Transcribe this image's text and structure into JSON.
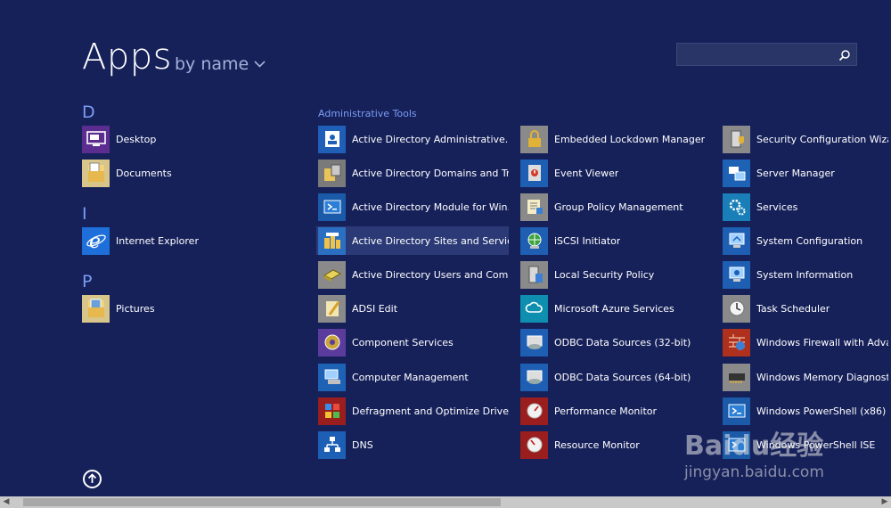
{
  "header": {
    "title": "Apps",
    "sort_label": "by name",
    "search_placeholder": ""
  },
  "letters": {
    "d": "D",
    "i": "I",
    "p": "P"
  },
  "groups": {
    "admin_tools": "Administrative Tools"
  },
  "col1": [
    {
      "label": "Desktop",
      "icon": "desktop-icon"
    },
    {
      "label": "Documents",
      "icon": "documents-folder-icon"
    },
    {
      "label": "Internet Explorer",
      "icon": "internet-explorer-icon"
    },
    {
      "label": "Pictures",
      "icon": "pictures-folder-icon"
    }
  ],
  "col2": [
    {
      "label": "Active Directory Administrative...",
      "icon": "ad-admin-center-icon"
    },
    {
      "label": "Active Directory Domains and Tr...",
      "icon": "ad-domains-trusts-icon"
    },
    {
      "label": "Active Directory Module for Win...",
      "icon": "powershell-module-icon"
    },
    {
      "label": "Active Directory Sites and Services",
      "icon": "ad-sites-services-icon"
    },
    {
      "label": "Active Directory Users and Com...",
      "icon": "ad-users-computers-icon"
    },
    {
      "label": "ADSI Edit",
      "icon": "adsi-edit-icon"
    },
    {
      "label": "Component Services",
      "icon": "component-services-icon"
    },
    {
      "label": "Computer Management",
      "icon": "computer-management-icon"
    },
    {
      "label": "Defragment and Optimize Drives",
      "icon": "defragment-icon"
    },
    {
      "label": "DNS",
      "icon": "dns-icon"
    }
  ],
  "col3": [
    {
      "label": "Embedded Lockdown Manager",
      "icon": "lock-icon"
    },
    {
      "label": "Event Viewer",
      "icon": "event-viewer-icon"
    },
    {
      "label": "Group Policy Management",
      "icon": "group-policy-icon"
    },
    {
      "label": "iSCSI Initiator",
      "icon": "iscsi-globe-icon"
    },
    {
      "label": "Local Security Policy",
      "icon": "security-policy-icon"
    },
    {
      "label": "Microsoft Azure Services",
      "icon": "azure-cloud-icon"
    },
    {
      "label": "ODBC Data Sources (32-bit)",
      "icon": "odbc-icon"
    },
    {
      "label": "ODBC Data Sources (64-bit)",
      "icon": "odbc-icon"
    },
    {
      "label": "Performance Monitor",
      "icon": "performance-monitor-icon"
    },
    {
      "label": "Resource Monitor",
      "icon": "resource-monitor-icon"
    }
  ],
  "col4": [
    {
      "label": "Security Configuration Wizard",
      "icon": "security-wizard-icon"
    },
    {
      "label": "Server Manager",
      "icon": "server-manager-icon"
    },
    {
      "label": "Services",
      "icon": "services-gears-icon"
    },
    {
      "label": "System Configuration",
      "icon": "system-configuration-icon"
    },
    {
      "label": "System Information",
      "icon": "system-information-icon"
    },
    {
      "label": "Task Scheduler",
      "icon": "task-scheduler-clock-icon"
    },
    {
      "label": "Windows Firewall with Advanced Security",
      "icon": "firewall-icon"
    },
    {
      "label": "Windows Memory Diagnostic",
      "icon": "memory-chip-icon"
    },
    {
      "label": "Windows PowerShell (x86)",
      "icon": "powershell-icon"
    },
    {
      "label": "Windows PowerShell ISE",
      "icon": "powershell-ise-icon"
    }
  ],
  "watermark": {
    "brand": "Baidu经验",
    "url": "jingyan.baidu.com"
  },
  "colors": {
    "background": "#16215a",
    "accent_letter": "#7b9cf4",
    "selected_tile": "#2b3a76"
  }
}
